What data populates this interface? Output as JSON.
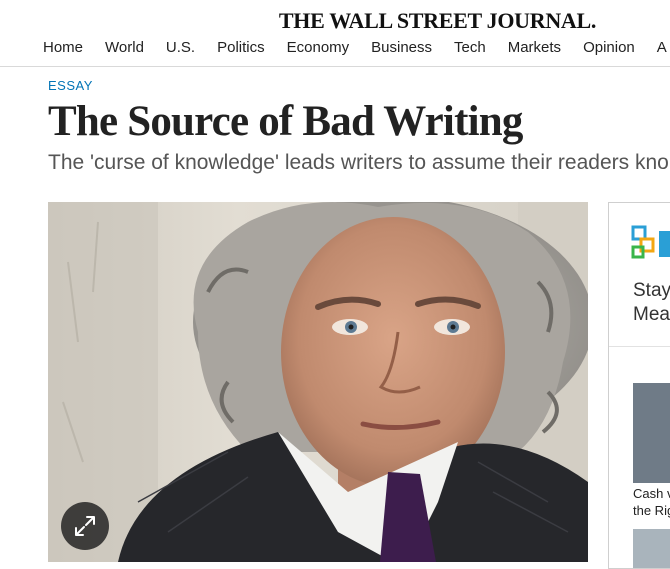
{
  "masthead": {
    "logo_text": "THE WALL STREET JOURNAL."
  },
  "nav": {
    "items": [
      "Home",
      "World",
      "U.S.",
      "Politics",
      "Economy",
      "Business",
      "Tech",
      "Markets",
      "Opinion",
      "A"
    ]
  },
  "article": {
    "kicker": "ESSAY",
    "headline": "The Source of Bad Writing",
    "dek": "The 'curse of knowledge' leads writers to assume their readers kno"
  },
  "hero": {
    "expand_icon": "expand-icon"
  },
  "sidebar_ad": {
    "headline_line1": "Stay",
    "headline_line2": "Mea",
    "caption_line1": "Cash v",
    "caption_line2": "the Rig"
  },
  "colors": {
    "kicker": "#0274b6",
    "headline": "#222222",
    "dek": "#555555"
  }
}
